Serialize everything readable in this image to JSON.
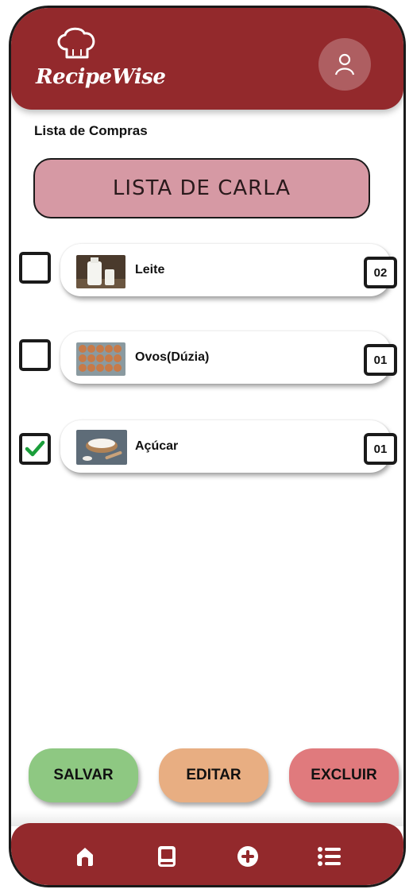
{
  "app": {
    "brand": "RecipeWise"
  },
  "header": {
    "title": "Lista de Compras"
  },
  "list": {
    "name": "LISTA DE CARLA"
  },
  "items": [
    {
      "name": "Leite",
      "quantity": "02",
      "checked": false
    },
    {
      "name": "Ovos(Dúzia)",
      "quantity": "01",
      "checked": false
    },
    {
      "name": "Açúcar",
      "quantity": "01",
      "checked": true
    }
  ],
  "actions": {
    "save": "SALVAR",
    "edit": "EDITAR",
    "delete": "EXCLUIR"
  },
  "nav": {
    "icons": [
      "home-icon",
      "book-icon",
      "add-circle-icon",
      "list-icon"
    ]
  },
  "colors": {
    "primary": "#93292c",
    "list_name_bg": "#d699a4",
    "save": "#8ec882",
    "edit": "#e8ae82",
    "delete": "#e07a7d",
    "check": "#1a9e3a"
  }
}
